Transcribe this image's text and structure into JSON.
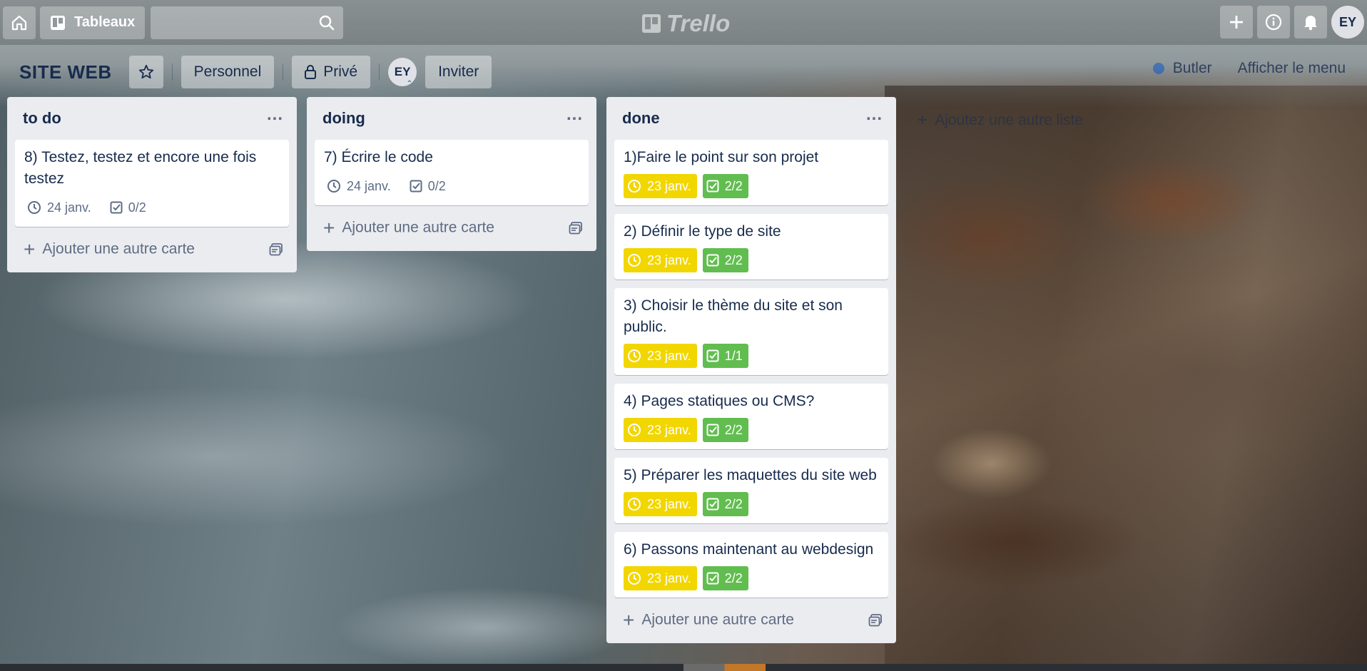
{
  "header": {
    "boards_label": "Tableaux",
    "logo_text": "Trello",
    "avatar_initials": "EY"
  },
  "board": {
    "title": "SITE WEB",
    "visibility_team": "Personnel",
    "privacy": "Privé",
    "member_initials": "EY",
    "invite_label": "Inviter",
    "butler_label": "Butler",
    "menu_label": "Afficher le menu",
    "add_list_label": "Ajoutez une autre liste"
  },
  "lists": [
    {
      "title": "to do",
      "add_card_label": "Ajouter une autre carte",
      "cards": [
        {
          "title": "8) Testez, testez et encore une fois testez",
          "due": "24 janv.",
          "checklist": "0/2",
          "status": "plain"
        }
      ]
    },
    {
      "title": "doing",
      "add_card_label": "Ajouter une autre carte",
      "cards": [
        {
          "title": "7) Écrire le code",
          "due": "24 janv.",
          "checklist": "0/2",
          "status": "plain"
        }
      ]
    },
    {
      "title": "done",
      "add_card_label": "Ajouter une autre carte",
      "cards": [
        {
          "title": "1)Faire le point sur son projet",
          "due": "23 janv.",
          "checklist": "2/2",
          "status": "complete"
        },
        {
          "title": "2) Définir le type de site",
          "due": "23 janv.",
          "checklist": "2/2",
          "status": "complete"
        },
        {
          "title": "3) Choisir le thème du site et son public.",
          "due": "23 janv.",
          "checklist": "1/1",
          "status": "complete"
        },
        {
          "title": "4) Pages statiques ou CMS?",
          "due": "23 janv.",
          "checklist": "2/2",
          "status": "complete"
        },
        {
          "title": "5) Préparer les maquettes du site web",
          "due": "23 janv.",
          "checklist": "2/2",
          "status": "complete"
        },
        {
          "title": "6) Passons maintenant au webdesign",
          "due": "23 janv.",
          "checklist": "2/2",
          "status": "complete"
        }
      ]
    }
  ],
  "colors": {
    "due_badge": "#f2d600",
    "checklist_badge": "#61bd4f",
    "list_background": "#ebecf0"
  }
}
